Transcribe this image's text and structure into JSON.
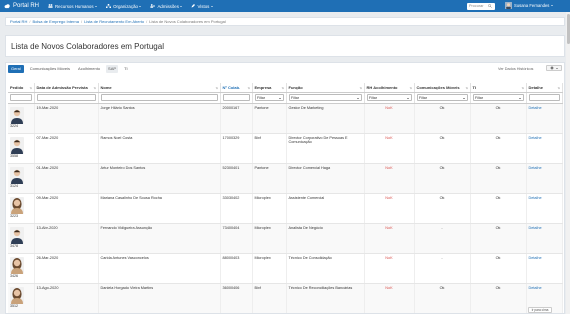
{
  "nav": {
    "brand": "Portal RH",
    "menus": [
      {
        "label": "Recursos Humanos",
        "icon": "users-icon"
      },
      {
        "label": "Organização",
        "icon": "sitemap-icon"
      },
      {
        "label": "Admissões",
        "icon": "user-plus-icon"
      },
      {
        "label": "Vistos",
        "icon": "pencil-icon"
      }
    ],
    "search_placeholder": "Procurar",
    "user_name": "Susana Fernandes"
  },
  "breadcrumb": {
    "items": [
      "Portal RH",
      "Bolsa de Emprego Interna",
      "Lista de Recrutamento Em Aberto"
    ],
    "current": "Lista de Novos Colaboradores em Portugal"
  },
  "page_title": "Lista de Novos Colaboradores em Portugal",
  "tabs": [
    {
      "label": "Geral",
      "active": true
    },
    {
      "label": "Comunicações Móveis",
      "active": false
    },
    {
      "label": "Acolhimento",
      "active": false
    },
    {
      "label": "SAP",
      "active": false
    },
    {
      "label": "TI",
      "active": false
    }
  ],
  "show_hidden_label": "Ver Dados Históricos",
  "columns": [
    "Pedido",
    "Data de Admissão Prevista",
    "Nome",
    "Nº Colab.",
    "Empresa",
    "Função",
    "RH Acolhimento",
    "Comunicações Móveis",
    "TI",
    "Detalhe"
  ],
  "filter_select_label": "Filtar",
  "rows": [
    {
      "pedido": "3224",
      "data": "19-Mar-2020",
      "nome": "Jorge Hilário Santos",
      "num": "20000167",
      "empresa": "Pantone",
      "funcao": "Gestor De Marketing",
      "rh": "NoK",
      "com": "Ok",
      "ti": "Ok",
      "detalhe": "Detalhe",
      "gender": "m"
    },
    {
      "pedido": "3558",
      "data": "07-Mar-2020",
      "nome": "Ramos Noel Costa",
      "num": "17000329",
      "empresa": "Bixf",
      "funcao": "Director Corporativo De Pessoas E Comunicação",
      "rh": "NoK",
      "com": "Ok",
      "ti": "Ok",
      "detalhe": "Detalhe",
      "gender": "m"
    },
    {
      "pedido": "3124",
      "data": "01-Mar-2020",
      "nome": "Artur Monteiro Dos Santos",
      "num": "52300401",
      "empresa": "Pantone",
      "funcao": "Director Comercial Haga",
      "rh": "NoK",
      "com": "Ok",
      "ti": "Ok",
      "detalhe": "Detalhe",
      "gender": "m"
    },
    {
      "pedido": "3223",
      "data": "09-Mar-2020",
      "nome": "Mariana Casalinho De Sousa Rocha",
      "num": "33030402",
      "empresa": "Microplex",
      "funcao": "Assistente Comercial",
      "rh": "NoK",
      "com": "Ok",
      "ti": "Ok",
      "detalhe": "Detalhe",
      "gender": "f"
    },
    {
      "pedido": "3478",
      "data": "13-Abr-2020",
      "nome": "Fernando Vidigueira Assunção",
      "num": "73400404",
      "empresa": "Microplex",
      "funcao": "Analista De Negócio",
      "rh": "NoK",
      "com": "-",
      "ti": "Ok",
      "detalhe": "Detalhe",
      "gender": "m"
    },
    {
      "pedido": "3426",
      "data": "26-Mar-2020",
      "nome": "Carida Antunes Vasconcelos",
      "num": "88000403",
      "empresa": "Microplex",
      "funcao": "Técnico De Consolidação",
      "rh": "NoK",
      "com": "-",
      "ti": "Ok",
      "detalhe": "Detalhe",
      "gender": "f"
    },
    {
      "pedido": "3512",
      "data": "13-Ago-2020",
      "nome": "Daniela Horgado Vieira Martins",
      "num": "36000406",
      "empresa": "Bixf",
      "funcao": "Técnico De Reconciliações Bancárias",
      "rh": "NoK",
      "com": "Ok",
      "ti": "Ok",
      "detalhe": "Detalhe",
      "gender": "f"
    }
  ],
  "go_up_label": "Ir para cima",
  "colors": {
    "navbar": "#1f6fb5",
    "accent": "#1f6fb5",
    "nok": "#d9534f"
  }
}
